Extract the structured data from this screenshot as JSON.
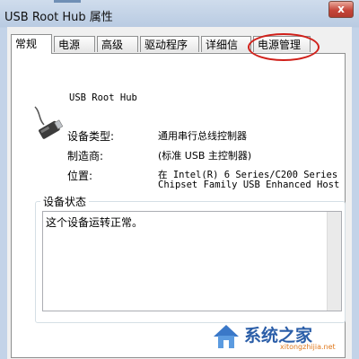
{
  "window": {
    "title": "USB Root Hub 属性",
    "close_label": "x"
  },
  "tabs": [
    {
      "label": "常规",
      "active": true
    },
    {
      "label": "电源",
      "active": false
    },
    {
      "label": "高级",
      "active": false
    },
    {
      "label": "驱动程序",
      "active": false
    },
    {
      "label": "详细信息",
      "active": false
    },
    {
      "label": "电源管理",
      "active": false,
      "highlighted": true
    }
  ],
  "device": {
    "name": "USB Root Hub",
    "icon": "usb-plug-icon",
    "props": [
      {
        "label": "设备类型:",
        "value": "通用串行总线控制器"
      },
      {
        "label": "制造商:",
        "value": "(标准 USB 主控制器)"
      },
      {
        "label": "位置:",
        "value": "在 Intel(R) 6 Series/C200 Series",
        "value2": "Chipset Family USB Enhanced Host"
      }
    ]
  },
  "status_group": {
    "title": "设备状态",
    "text": "这个设备运转正常。"
  },
  "watermark": {
    "text": "系统之家",
    "url": "xitongzhijia.net"
  },
  "colors": {
    "highlight_circle": "#d0201a",
    "watermark": "#2b5ea8"
  }
}
